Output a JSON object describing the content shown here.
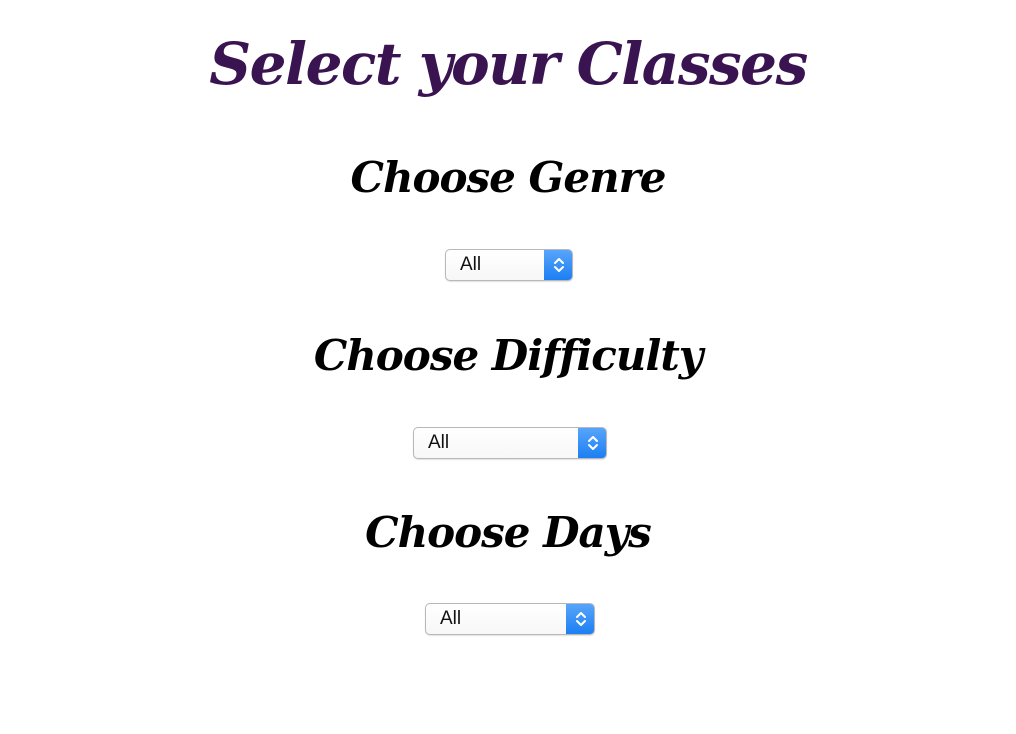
{
  "page": {
    "title": "Select your Classes",
    "title_color": "#3a1450",
    "accent_color": "#1a7ef2"
  },
  "filters": [
    {
      "heading": "Choose Genre",
      "selected": "All"
    },
    {
      "heading": "Choose Difficulty",
      "selected": "All"
    },
    {
      "heading": "Choose Days",
      "selected": "All"
    }
  ],
  "icons": {
    "select_arrow": "chevron-up-down-icon"
  }
}
